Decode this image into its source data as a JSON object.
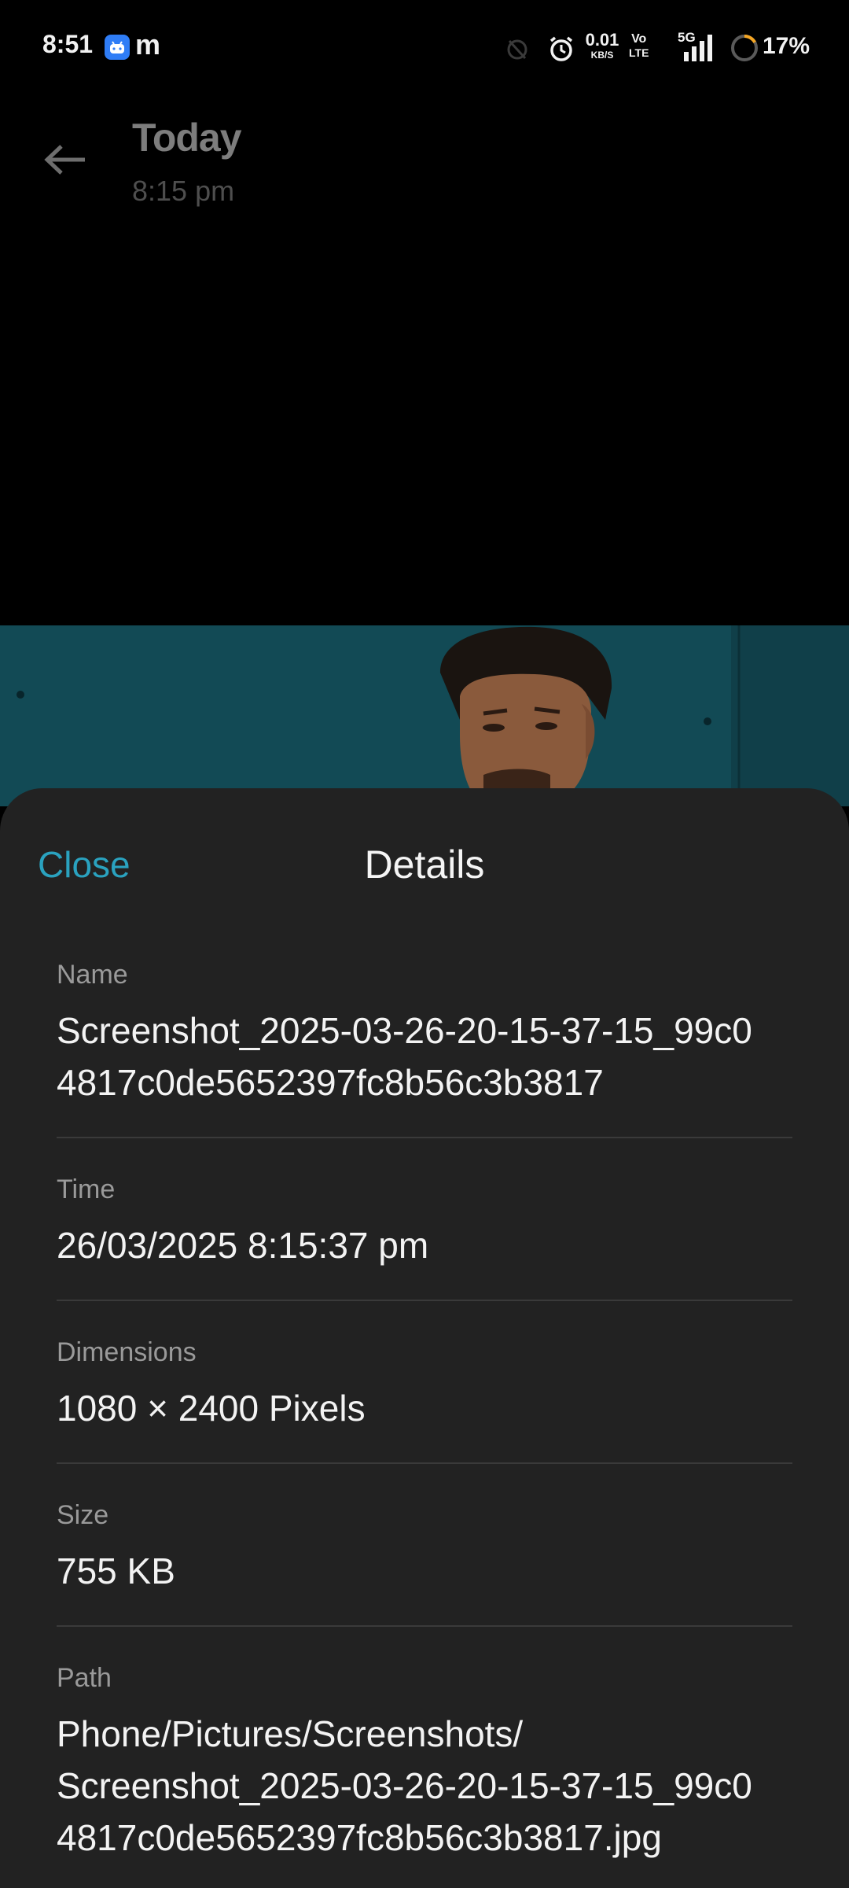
{
  "status_bar": {
    "time": "8:51",
    "notification_letter": "m",
    "net_speed_value": "0.01",
    "net_speed_unit": "KB/S",
    "volte_top": "Vo",
    "volte_bottom": "LTE",
    "network_type": "5G",
    "battery_percent": "17%",
    "battery_level": 0.17
  },
  "app_bar": {
    "title": "Today",
    "subtitle": "8:15 pm"
  },
  "sheet": {
    "close_label": "Close",
    "title": "Details",
    "rows": [
      {
        "label": "Name",
        "value_lines": [
          "Screenshot_2025-03-26-20-15-37-15_99c0",
          "4817c0de5652397fc8b56c3b3817"
        ]
      },
      {
        "label": "Time",
        "value_lines": [
          "26/03/2025 8:15:37 pm"
        ]
      },
      {
        "label": "Dimensions",
        "value_lines": [
          "1080 × 2400 Pixels"
        ]
      },
      {
        "label": "Size",
        "value_lines": [
          "755 KB"
        ]
      },
      {
        "label": "Path",
        "value_lines": [
          "Phone/Pictures/Screenshots/",
          "Screenshot_2025-03-26-20-15-37-15_99c0",
          "4817c0de5652397fc8b56c3b3817.jpg"
        ]
      }
    ]
  },
  "colors": {
    "accent": "#2aa2bf",
    "sheet_bg": "#222222",
    "background": "#000000"
  }
}
